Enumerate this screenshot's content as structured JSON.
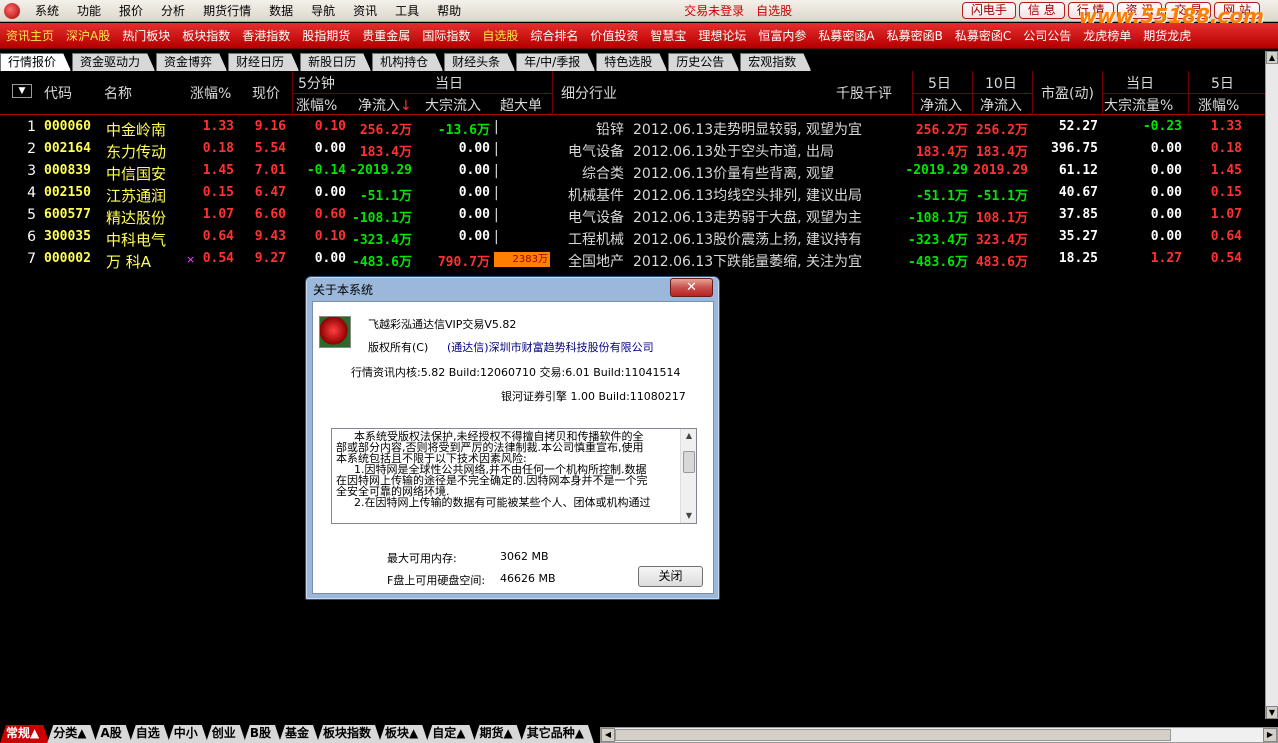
{
  "menubar": {
    "items": [
      "系统",
      "功能",
      "报价",
      "分析",
      "期货行情",
      "数据",
      "导航",
      "资讯",
      "工具",
      "帮助"
    ],
    "login_status": "交易未登录",
    "self_pick": "自选股",
    "right_buttons": [
      "闪电手",
      "信 息",
      "行 情",
      "资 讯",
      "交 易",
      "网 站"
    ],
    "watermark": "www.55188.com"
  },
  "redbar": {
    "items": [
      "资讯主页",
      "深沪A股",
      "热门板块",
      "板块指数",
      "香港指数",
      "股指期货",
      "贵重金属",
      "国际指数",
      "自选股",
      "综合排名",
      "价值投资",
      "智慧宝",
      "理想论坛",
      "恒富内参",
      "私募密函A",
      "私募密函B",
      "私募密函C",
      "公司公告",
      "龙虎榜单",
      "期货龙虎"
    ]
  },
  "tabs": [
    "行情报价",
    "资金驱动力",
    "资金博弈",
    "财经日历",
    "新股日历",
    "机构持仓",
    "财经头条",
    "年/中/季报",
    "特色选股",
    "历史公告",
    "宏观指数"
  ],
  "table": {
    "headers": {
      "code": "代码",
      "name": "名称",
      "change_pct": "涨幅%",
      "price": "现价",
      "min5_group": "5分钟",
      "min5_change": "涨幅%",
      "day_group": "当日",
      "net_inflow": "净流入",
      "block_inflow": "大宗流入",
      "super_large": "超大单",
      "industry": "细分行业",
      "review": "千股千评",
      "d5_group": "5日",
      "d5_net": "净流入",
      "d10_group": "10日",
      "d10_net": "净流入",
      "pe": "市盈(动)",
      "day2_group": "当日",
      "block_flow_pct": "大宗流量%",
      "d5b_group": "5日",
      "d5_change": "涨幅%",
      "sort_arrow": "▼",
      "sort_indicator": "↓"
    },
    "rows": [
      {
        "idx": "1",
        "code": "000060",
        "name": "中金岭南",
        "mark": "",
        "change": "1.33",
        "price": "9.16",
        "m5": "0.10",
        "net": "256.2万",
        "block": "-13.6万",
        "super": "",
        "super_pct": 0,
        "industry": "铅锌",
        "review": "2012.06.13走势明显较弱, 观望为宜",
        "d5": "256.2万",
        "d10": "256.2万",
        "pe": "52.27",
        "bflow": "-0.23",
        "d5chg": "1.33"
      },
      {
        "idx": "2",
        "code": "002164",
        "name": "东力传动",
        "mark": "",
        "change": "0.18",
        "price": "5.54",
        "m5": "0.00",
        "net": "183.4万",
        "block": "0.00",
        "super": "",
        "super_pct": 0,
        "industry": "电气设备",
        "review": "2012.06.13处于空头市道, 出局",
        "d5": "183.4万",
        "d10": "183.4万",
        "pe": "396.75",
        "bflow": "0.00",
        "d5chg": "0.18"
      },
      {
        "idx": "3",
        "code": "000839",
        "name": "中信国安",
        "mark": "",
        "change": "1.45",
        "price": "7.01",
        "m5": "-0.14",
        "net": "-2019.29",
        "block": "0.00",
        "super": "",
        "super_pct": 0,
        "industry": "综合类",
        "review": "2012.06.13价量有些背离, 观望",
        "d5": "-2019.29",
        "d10": "2019.29",
        "pe": "61.12",
        "bflow": "0.00",
        "d5chg": "1.45"
      },
      {
        "idx": "4",
        "code": "002150",
        "name": "江苏通润",
        "mark": "",
        "change": "0.15",
        "price": "6.47",
        "m5": "0.00",
        "net": "-51.1万",
        "block": "0.00",
        "super": "",
        "super_pct": 0,
        "industry": "机械基件",
        "review": "2012.06.13均线空头排列, 建议出局",
        "d5": "-51.1万",
        "d10": "-51.1万",
        "pe": "40.67",
        "bflow": "0.00",
        "d5chg": "0.15"
      },
      {
        "idx": "5",
        "code": "600577",
        "name": "精达股份",
        "mark": "",
        "change": "1.07",
        "price": "6.60",
        "m5": "0.60",
        "net": "-108.1万",
        "block": "0.00",
        "super": "",
        "super_pct": 0,
        "industry": "电气设备",
        "review": "2012.06.13走势弱于大盘, 观望为主",
        "d5": "-108.1万",
        "d10": "108.1万",
        "pe": "37.85",
        "bflow": "0.00",
        "d5chg": "1.07"
      },
      {
        "idx": "6",
        "code": "300035",
        "name": "中科电气",
        "mark": "",
        "change": "0.64",
        "price": "9.43",
        "m5": "0.10",
        "net": "-323.4万",
        "block": "0.00",
        "super": "",
        "super_pct": 0,
        "industry": "工程机械",
        "review": "2012.06.13股价震荡上扬, 建议持有",
        "d5": "-323.4万",
        "d10": "323.4万",
        "pe": "35.27",
        "bflow": "0.00",
        "d5chg": "0.64"
      },
      {
        "idx": "7",
        "code": "000002",
        "name": "万 科A",
        "mark": "×",
        "change": "0.54",
        "price": "9.27",
        "m5": "0.00",
        "net": "-483.6万",
        "block": "790.7万",
        "super": "2383万",
        "super_pct": 1.0,
        "industry": "全国地产",
        "review": "2012.06.13下跌能量萎缩, 关注为宜",
        "d5": "-483.6万",
        "d10": "483.6万",
        "pe": "18.25",
        "bflow": "1.27",
        "d5chg": "0.54"
      }
    ]
  },
  "bottom_tabs": [
    "常规▲",
    "分类▲",
    "A股",
    "自选",
    "中小",
    "创业",
    "B股",
    "基金",
    "板块指数",
    "板块▲",
    "自定▲",
    "期货▲",
    "其它品种▲"
  ],
  "dialog": {
    "title": "关于本系统",
    "close": "✕",
    "product": "飞越彩泓通达信VIP交易V5.82",
    "copyright_label": "版权所有(C)",
    "company": "(通达信)深圳市财富趋势科技股份有限公司",
    "kernel": "行情资讯内核:5.82 Build:12060710 交易:6.01 Build:11041514",
    "engine": "银河证券引擎 1.00 Build:11080217",
    "notice": [
      "本系统受版权法保护,未经授权不得擅自拷贝和传播软件的全",
      "部或部分内容,否则将受到严厉的法律制裁.本公司慎重宣布,使用",
      "本系统包括且不限于以下技术因素风险:",
      "1.因特网是全球性公共网络,并不由任何一个机构所控制.数据",
      "在因特网上传输的途径是不完全确定的.因特网本身并不是一个完",
      "全安全可靠的网络环境.",
      "2.在因特网上传输的数据有可能被某些个人、团体或机构通过"
    ],
    "mem_label": "最大可用内存:",
    "mem_value": "3062 MB",
    "disk_label": "F盘上可用硬盘空间:",
    "disk_value": "46626 MB",
    "button": "关闭"
  }
}
